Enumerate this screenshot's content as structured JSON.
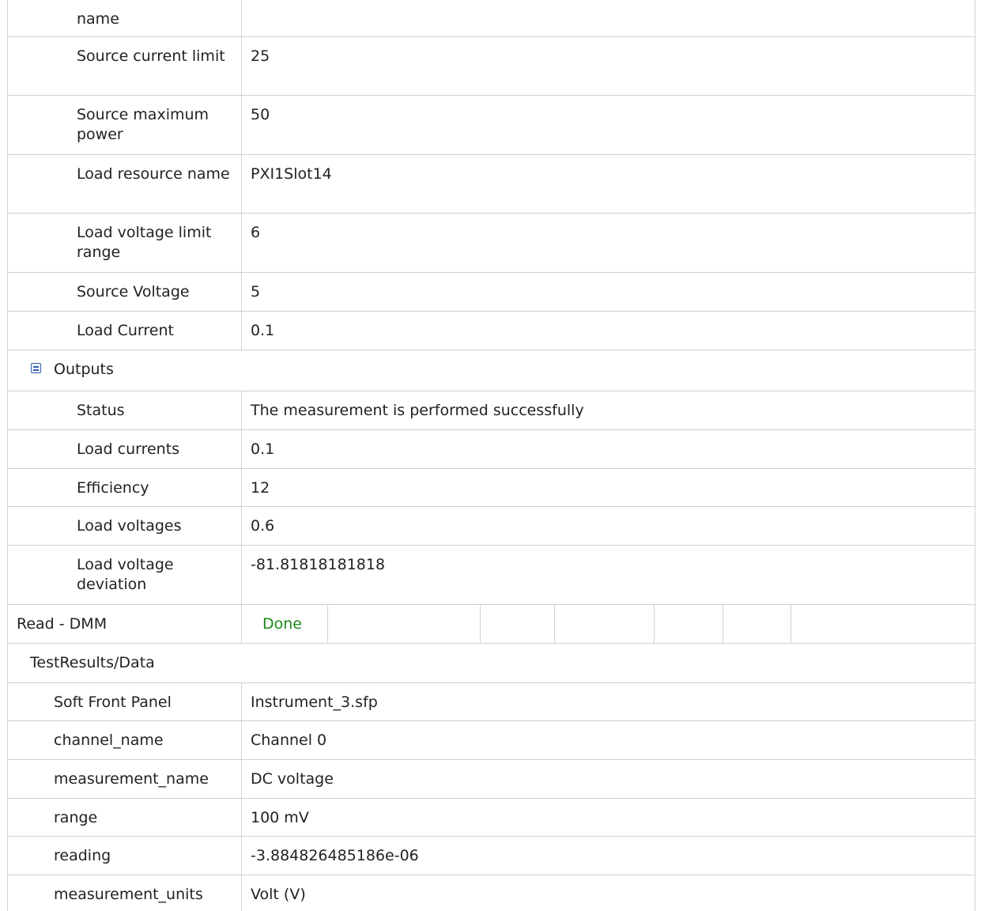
{
  "inputs_continued": [
    {
      "label": "name",
      "value": ""
    },
    {
      "label": "Source current limit",
      "value": "25"
    },
    {
      "label": "Source maximum power",
      "value": "50"
    },
    {
      "label": "Load resource name",
      "value": "PXI1Slot14"
    },
    {
      "label": "Load voltage limit range",
      "value": "6"
    },
    {
      "label": "Source Voltage",
      "value": "5"
    },
    {
      "label": "Load Current",
      "value": "0.1"
    }
  ],
  "outputs": {
    "label": "Outputs",
    "rows": [
      {
        "label": "Status",
        "value": "The measurement is performed successfully"
      },
      {
        "label": "Load currents",
        "value": "0.1"
      },
      {
        "label": "Efficiency",
        "value": "12"
      },
      {
        "label": "Load voltages",
        "value": "0.6"
      },
      {
        "label": "Load voltage deviation",
        "value": "-81.81818181818"
      }
    ]
  },
  "step": {
    "name": "Read - DMM",
    "status": "Done"
  },
  "test_results": {
    "label": "TestResults/Data",
    "rows": [
      {
        "label": "Soft Front Panel",
        "value": "Instrument_3.sfp"
      },
      {
        "label": "channel_name",
        "value": "Channel 0"
      },
      {
        "label": "measurement_name",
        "value": "DC voltage"
      },
      {
        "label": "range",
        "value": "100 mV"
      },
      {
        "label": "reading",
        "value": "-3.884826485186e-06"
      },
      {
        "label": "measurement_units",
        "value": "Volt (V)"
      }
    ]
  },
  "colors": {
    "done": "#1a8a1a",
    "grid": "#d0d0d0",
    "icon": "#3a5fa8"
  }
}
